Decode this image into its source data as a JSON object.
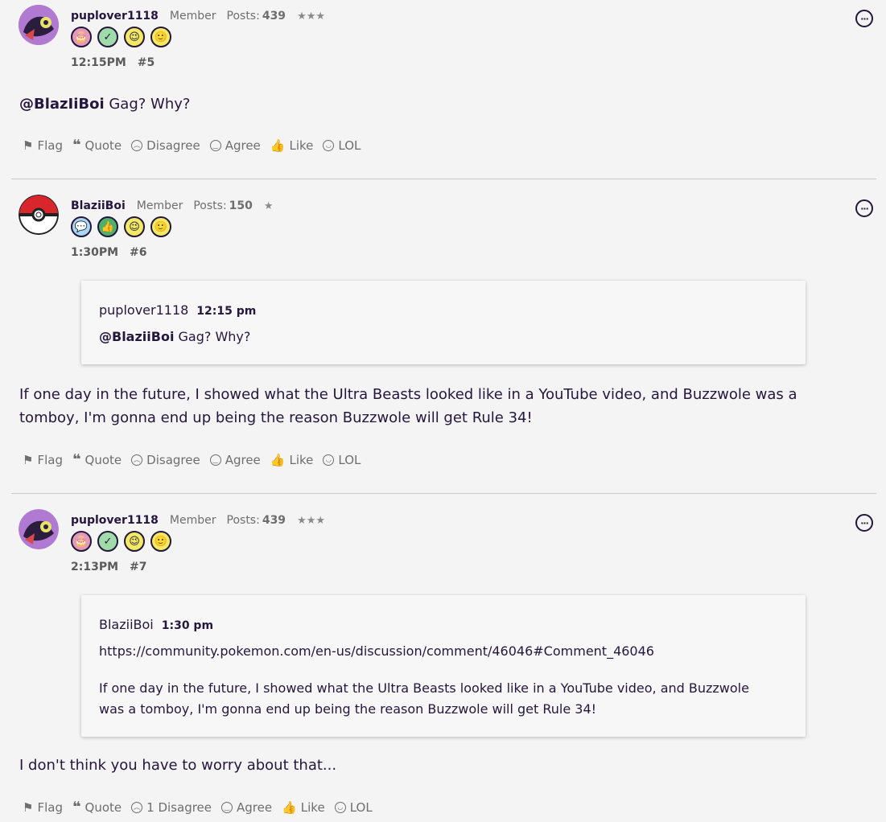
{
  "posts": [
    {
      "author": "puplover1118",
      "role": "Member",
      "posts_label": "Posts:",
      "posts_count": "439",
      "stars": "★★★",
      "time": "12:15PM",
      "number": "#5",
      "mention": "@BlazIiBoi",
      "text": " Gag? Why?",
      "actions": {
        "flag": "Flag",
        "quote": "Quote",
        "disagree": "Disagree",
        "agree": "Agree",
        "like": "Like",
        "lol": "LOL"
      }
    },
    {
      "author": "BlaziiBoi",
      "role": "Member",
      "posts_label": "Posts:",
      "posts_count": "150",
      "stars": "★",
      "time": "1:30PM",
      "number": "#6",
      "quote": {
        "author": "puplover1118",
        "time": "12:15 pm",
        "mention": "@BlaziiBoi",
        "text": " Gag? Why?"
      },
      "text": "If one day in the future, I showed what the Ultra Beasts looked like in a YouTube video, and Buzzwole was a tomboy, I'm gonna end up being the reason Buzzwole will get Rule 34!",
      "actions": {
        "flag": "Flag",
        "quote": "Quote",
        "disagree": "Disagree",
        "agree": "Agree",
        "like": "Like",
        "lol": "LOL"
      }
    },
    {
      "author": "puplover1118",
      "role": "Member",
      "posts_label": "Posts:",
      "posts_count": "439",
      "stars": "★★★",
      "time": "2:13PM",
      "number": "#7",
      "quote": {
        "author": "BlaziiBoi",
        "time": "1:30 pm",
        "link": "https://community.pokemon.com/en-us/discussion/comment/46046#Comment_46046",
        "text": "If one day in the future, I showed what the Ultra Beasts looked like in a YouTube video, and Buzzwole was a tomboy, I'm gonna end up being the reason Buzzwole will get Rule 34!"
      },
      "text": "I don't think you have to worry about that...",
      "actions": {
        "flag": "Flag",
        "quote": "Quote",
        "disagree": "1 Disagree",
        "agree": "Agree",
        "like": "Like",
        "lol": "LOL"
      }
    }
  ],
  "icons": {
    "flag": "flag-icon",
    "quote": "quote-icon",
    "disagree": "frown-icon",
    "agree": "smile-icon",
    "like": "thumbs-up-icon",
    "lol": "laugh-icon",
    "options": "options-icon"
  },
  "colors": {
    "text": "#23173d",
    "muted": "#6e6e6e",
    "background": "#f4f4f4"
  }
}
